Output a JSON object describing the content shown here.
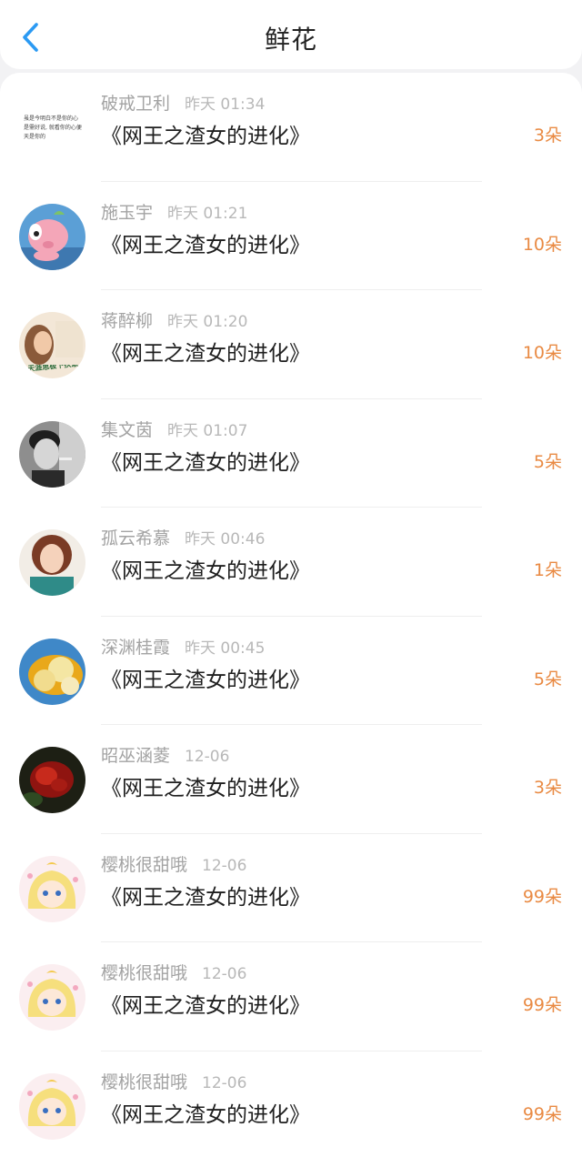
{
  "header": {
    "title": "鲜花",
    "back_icon": "chevron-left-icon",
    "accent_color": "#2b9af3"
  },
  "records": [
    {
      "name": "破戒卫利",
      "time": "昨天 01:34",
      "book": "《网王之渣女的进化》",
      "count": "3朵",
      "avatar": "text-note-avatar",
      "avatar_text": "虽是今明白不是你的心是需好说, 就看你的心便天是你的"
    },
    {
      "name": "施玉宇",
      "time": "昨天 01:21",
      "book": "《网王之渣女的进化》",
      "count": "10朵",
      "avatar": "pink-pig-avatar"
    },
    {
      "name": "蒋醉柳",
      "time": "昨天 01:20",
      "book": "《网王之渣女的进化》",
      "count": "10朵",
      "avatar": "girl-portrait-avatar",
      "avatar_text": "天涯思极下扶意"
    },
    {
      "name": "集文茵",
      "time": "昨天 01:07",
      "book": "《网王之渣女的进化》",
      "count": "5朵",
      "avatar": "man-bw-portrait-avatar"
    },
    {
      "name": "孤云希慕",
      "time": "昨天 00:46",
      "book": "《网王之渣女的进化》",
      "count": "1朵",
      "avatar": "woman-portrait-avatar"
    },
    {
      "name": "深渊桂霞",
      "time": "昨天 00:45",
      "book": "《网王之渣女的进化》",
      "count": "5朵",
      "avatar": "fruit-avatar"
    },
    {
      "name": "昭巫涵菱",
      "time": "12-06",
      "book": "《网王之渣女的进化》",
      "count": "3朵",
      "avatar": "red-rose-avatar"
    },
    {
      "name": "樱桃很甜哦",
      "time": "12-06",
      "book": "《网王之渣女的进化》",
      "count": "99朵",
      "avatar": "sailor-moon-avatar"
    },
    {
      "name": "樱桃很甜哦",
      "time": "12-06",
      "book": "《网王之渣女的进化》",
      "count": "99朵",
      "avatar": "sailor-moon-avatar"
    },
    {
      "name": "樱桃很甜哦",
      "time": "12-06",
      "book": "《网王之渣女的进化》",
      "count": "99朵",
      "avatar": "sailor-moon-avatar"
    }
  ],
  "colors": {
    "count": "#e98a43",
    "name": "#a3a3a3",
    "book": "#1f1f1f",
    "background": "#f2f2f4"
  }
}
